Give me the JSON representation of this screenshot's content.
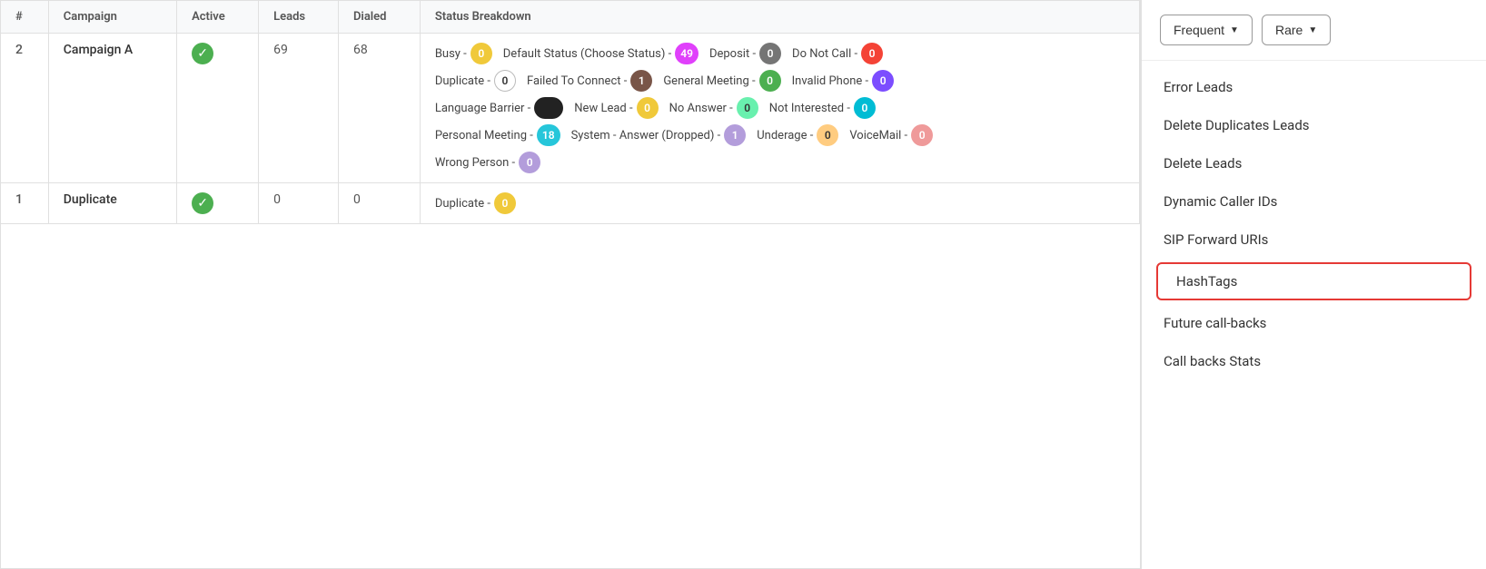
{
  "table": {
    "columns": [
      "#",
      "Campaign",
      "Active",
      "Leads",
      "Dialed",
      "Status Breakdown"
    ],
    "rows": [
      {
        "number": "2",
        "campaign": "Campaign A",
        "active": true,
        "leads": "69",
        "dialed": "68",
        "statuses": [
          {
            "label": "Busy -",
            "value": "0",
            "badgeClass": "badge-yellow"
          },
          {
            "label": "Default Status (Choose Status) -",
            "value": "49",
            "badgeClass": "badge-magenta"
          },
          {
            "label": "Deposit -",
            "value": "0",
            "badgeClass": "badge-gray-dark"
          },
          {
            "label": "Do Not Call -",
            "value": "0",
            "badgeClass": "badge-red"
          },
          {
            "label": "Duplicate -",
            "value": "0",
            "badgeClass": "badge-white"
          },
          {
            "label": "Failed To Connect -",
            "value": "1",
            "badgeClass": "badge-brown"
          },
          {
            "label": "General Meeting -",
            "value": "0",
            "badgeClass": "badge-green"
          },
          {
            "label": "Invalid Phone -",
            "value": "0",
            "badgeClass": "badge-purple"
          },
          {
            "label": "Language Barrier -",
            "value": "",
            "badgeClass": "badge-black",
            "isBlack": true
          },
          {
            "label": "New Lead -",
            "value": "0",
            "badgeClass": "badge-yellow"
          },
          {
            "label": "No Answer -",
            "value": "0",
            "badgeClass": "badge-light-green"
          },
          {
            "label": "Not Interested -",
            "value": "0",
            "badgeClass": "badge-cyan"
          },
          {
            "label": "Personal Meeting -",
            "value": "18",
            "badgeClass": "badge-teal"
          },
          {
            "label": "System - Answer (Dropped) -",
            "value": "1",
            "badgeClass": "badge-lavender"
          },
          {
            "label": "Underage -",
            "value": "0",
            "badgeClass": "badge-orange-light"
          },
          {
            "label": "VoiceMail -",
            "value": "0",
            "badgeClass": "badge-salmon"
          },
          {
            "label": "Wrong Person -",
            "value": "0",
            "badgeClass": "badge-lavender"
          }
        ]
      },
      {
        "number": "1",
        "campaign": "Duplicate",
        "active": true,
        "leads": "0",
        "dialed": "0",
        "statuses": [
          {
            "label": "Duplicate -",
            "value": "0",
            "badgeClass": "badge-yellow"
          }
        ]
      }
    ]
  },
  "panel": {
    "buttons": [
      {
        "label": "Frequent",
        "id": "frequent-btn"
      },
      {
        "label": "Rare",
        "id": "rare-btn"
      }
    ],
    "menuItems": [
      {
        "label": "Error Leads",
        "active": false
      },
      {
        "label": "Delete Duplicates Leads",
        "active": false
      },
      {
        "label": "Delete Leads",
        "active": false
      },
      {
        "label": "Dynamic Caller IDs",
        "active": false
      },
      {
        "label": "SIP Forward URIs",
        "active": false
      },
      {
        "label": "HashTags",
        "active": true
      },
      {
        "label": "Future call-backs",
        "active": false
      },
      {
        "label": "Call backs Stats",
        "active": false
      }
    ]
  }
}
